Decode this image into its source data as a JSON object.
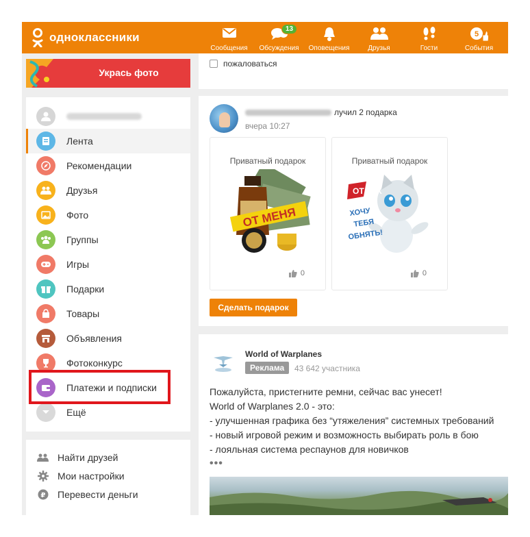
{
  "app": {
    "name": "одноклассники"
  },
  "colors": {
    "brand": "#ee8208",
    "highlight": "#e0171c",
    "badge": "#54b234"
  },
  "nav": {
    "items": [
      {
        "label": "Сообщения",
        "icon": "envelope-icon"
      },
      {
        "label": "Обсуждения",
        "icon": "chat-bubbles-icon",
        "badge": "13"
      },
      {
        "label": "Оповещения",
        "icon": "bell-icon"
      },
      {
        "label": "Друзья",
        "icon": "friends-icon"
      },
      {
        "label": "Гости",
        "icon": "footprints-icon"
      },
      {
        "label": "События",
        "icon": "events-icon",
        "badge": "5"
      }
    ]
  },
  "banner": {
    "label": "Укрась фото"
  },
  "sidebar": {
    "items": [
      {
        "label": "Лента",
        "icon": "feed-icon",
        "color": "#5eb7e6"
      },
      {
        "label": "Рекомендации",
        "icon": "compass-icon",
        "color": "#f07a67"
      },
      {
        "label": "Друзья",
        "icon": "friends-icon",
        "color": "#f8b21c"
      },
      {
        "label": "Фото",
        "icon": "photo-icon",
        "color": "#f8b21c"
      },
      {
        "label": "Группы",
        "icon": "groups-icon",
        "color": "#8cc753"
      },
      {
        "label": "Игры",
        "icon": "gamepad-icon",
        "color": "#f07a67"
      },
      {
        "label": "Подарки",
        "icon": "gift-icon",
        "color": "#4fc5c0"
      },
      {
        "label": "Товары",
        "icon": "bag-icon",
        "color": "#f07a67"
      },
      {
        "label": "Объявления",
        "icon": "store-icon",
        "color": "#b55b3b"
      },
      {
        "label": "Фотоконкурс",
        "icon": "trophy-icon",
        "color": "#f07a67"
      },
      {
        "label": "Платежи и подписки",
        "icon": "wallet-icon",
        "color": "#a965c9"
      },
      {
        "label": "Ещё",
        "icon": "chevron-down-icon",
        "color": "#c8c8c8"
      }
    ]
  },
  "links": {
    "items": [
      {
        "label": "Найти друзей",
        "icon": "find-friends-icon"
      },
      {
        "label": "Мои настройки",
        "icon": "gear-icon"
      },
      {
        "label": "Перевести деньги",
        "icon": "ruble-icon"
      }
    ]
  },
  "feed": {
    "complain_label": "пожаловаться",
    "gift_post": {
      "action": "лучил 2 подарка",
      "time": "вчера 10:27",
      "gifts": [
        {
          "title": "Приватный подарок",
          "likes": "0"
        },
        {
          "title": "Приватный подарок",
          "likes": "0"
        }
      ],
      "button": "Сделать подарок"
    },
    "ad_post": {
      "title": "World of Warplanes",
      "tag": "Реклама",
      "members": "43 642 участника",
      "lines": [
        "Пожалуйста, пристегните ремни, сейчас вас унесет!",
        "World of Warplanes 2.0 - это:",
        "- улучшенная графика без “утяжеления” системных требований",
        "- новый игровой режим и возможность выбирать роль в бою",
        "- лояльная система респаунов для новичков"
      ],
      "more": "•••",
      "gift_art_text_1": "ОТ МЕНЯ",
      "gift_art_text_2": "ОТ ТАК ХОЧУ ТЕБЯ ОБНЯТЬ!"
    }
  }
}
